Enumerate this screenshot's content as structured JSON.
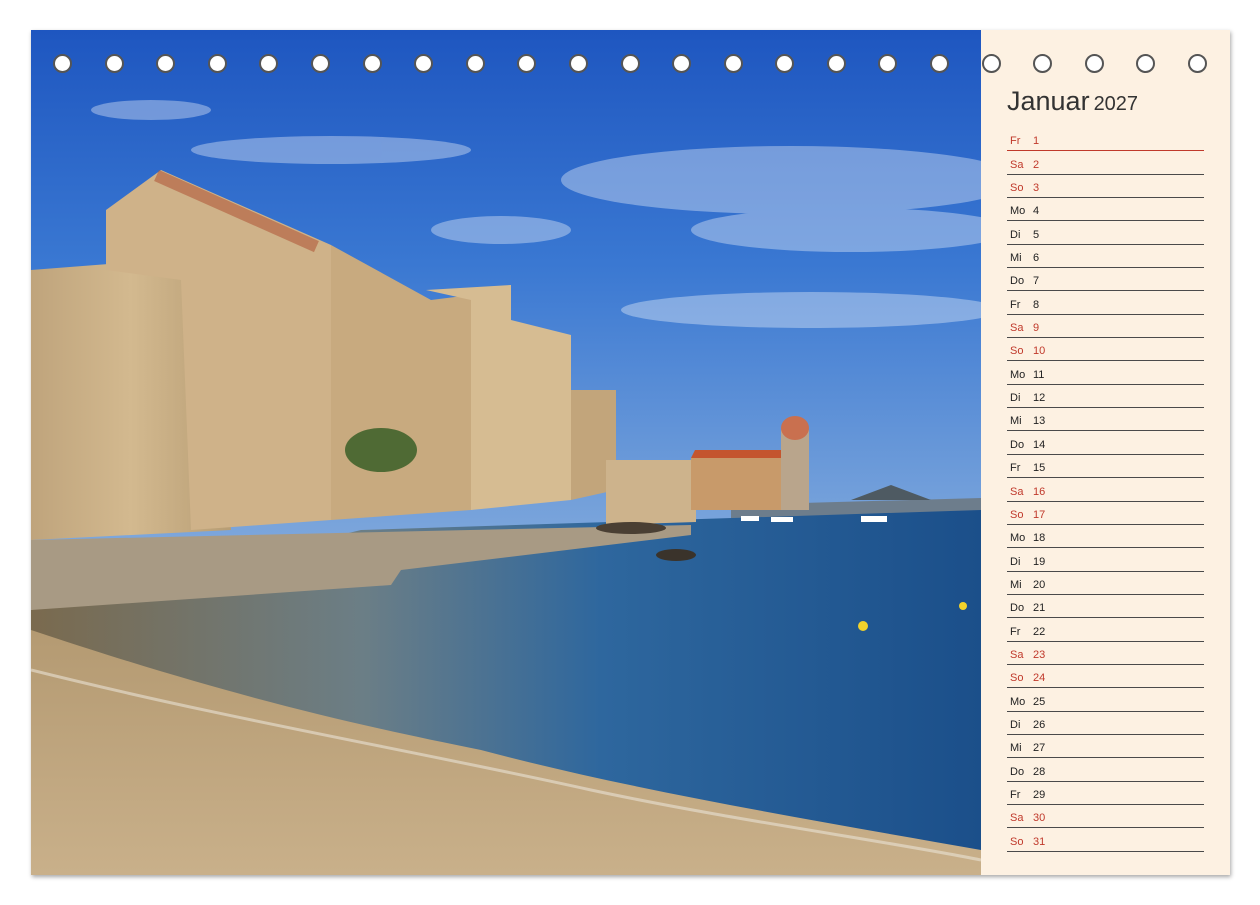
{
  "calendar": {
    "month": "Januar",
    "year": "2027",
    "days": [
      {
        "wd": "Fr",
        "d": "1",
        "weekend": false,
        "holiday": true
      },
      {
        "wd": "Sa",
        "d": "2",
        "weekend": true
      },
      {
        "wd": "So",
        "d": "3",
        "weekend": true
      },
      {
        "wd": "Mo",
        "d": "4",
        "weekend": false
      },
      {
        "wd": "Di",
        "d": "5",
        "weekend": false
      },
      {
        "wd": "Mi",
        "d": "6",
        "weekend": false
      },
      {
        "wd": "Do",
        "d": "7",
        "weekend": false
      },
      {
        "wd": "Fr",
        "d": "8",
        "weekend": false
      },
      {
        "wd": "Sa",
        "d": "9",
        "weekend": true
      },
      {
        "wd": "So",
        "d": "10",
        "weekend": true
      },
      {
        "wd": "Mo",
        "d": "11",
        "weekend": false
      },
      {
        "wd": "Di",
        "d": "12",
        "weekend": false
      },
      {
        "wd": "Mi",
        "d": "13",
        "weekend": false
      },
      {
        "wd": "Do",
        "d": "14",
        "weekend": false
      },
      {
        "wd": "Fr",
        "d": "15",
        "weekend": false
      },
      {
        "wd": "Sa",
        "d": "16",
        "weekend": true
      },
      {
        "wd": "So",
        "d": "17",
        "weekend": true
      },
      {
        "wd": "Mo",
        "d": "18",
        "weekend": false
      },
      {
        "wd": "Di",
        "d": "19",
        "weekend": false
      },
      {
        "wd": "Mi",
        "d": "20",
        "weekend": false
      },
      {
        "wd": "Do",
        "d": "21",
        "weekend": false
      },
      {
        "wd": "Fr",
        "d": "22",
        "weekend": false
      },
      {
        "wd": "Sa",
        "d": "23",
        "weekend": true
      },
      {
        "wd": "So",
        "d": "24",
        "weekend": true
      },
      {
        "wd": "Mo",
        "d": "25",
        "weekend": false
      },
      {
        "wd": "Di",
        "d": "26",
        "weekend": false
      },
      {
        "wd": "Mi",
        "d": "27",
        "weekend": false
      },
      {
        "wd": "Do",
        "d": "28",
        "weekend": false
      },
      {
        "wd": "Fr",
        "d": "29",
        "weekend": false
      },
      {
        "wd": "Sa",
        "d": "30",
        "weekend": true
      },
      {
        "wd": "So",
        "d": "31",
        "weekend": true
      }
    ]
  },
  "binding": {
    "hole_count": 23
  },
  "colors": {
    "weekend": "#c0392b",
    "paper": "#fdf1e2",
    "sky": "#2a5fb8",
    "sea": "#1f5d9a",
    "stone": "#c9a97a",
    "sand": "#c4a77c"
  }
}
